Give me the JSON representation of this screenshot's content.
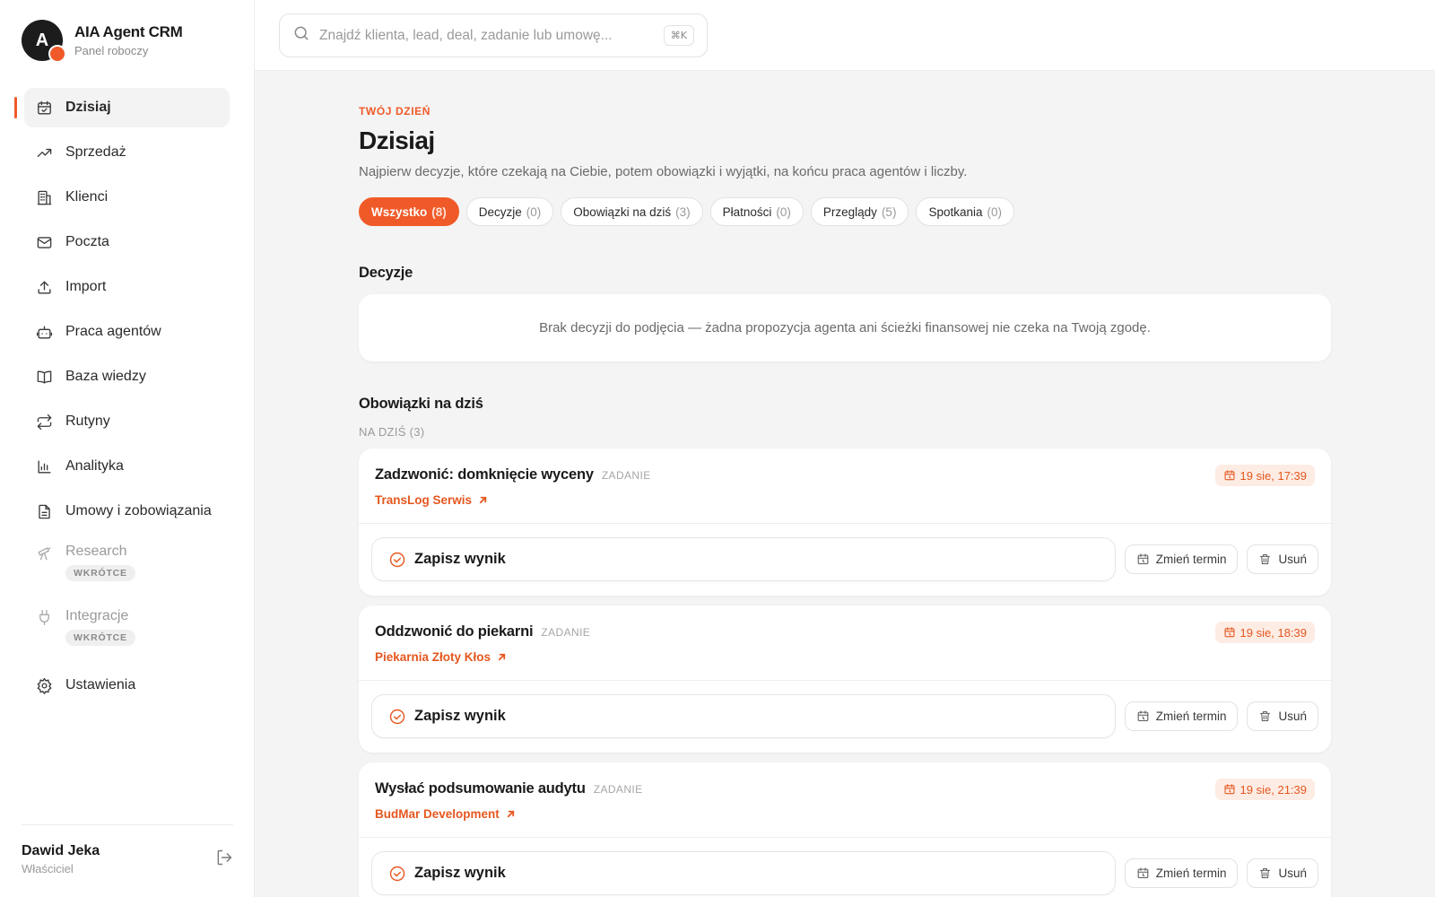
{
  "brand": {
    "avatar_letter": "A",
    "title": "AIA Agent CRM",
    "subtitle": "Panel roboczy"
  },
  "search": {
    "placeholder": "Znajdź klienta, lead, deal, zadanie lub umowę...",
    "shortcut": "⌘K"
  },
  "sidebar": {
    "items": [
      {
        "label": "Dzisiaj",
        "icon": "calendar-check-icon",
        "active": true
      },
      {
        "label": "Sprzedaż",
        "icon": "trending-up-icon"
      },
      {
        "label": "Klienci",
        "icon": "building-icon"
      },
      {
        "label": "Poczta",
        "icon": "mail-icon"
      },
      {
        "label": "Import",
        "icon": "upload-icon"
      },
      {
        "label": "Praca agentów",
        "icon": "bot-icon"
      },
      {
        "label": "Baza wiedzy",
        "icon": "book-icon"
      },
      {
        "label": "Rutyny",
        "icon": "repeat-icon"
      },
      {
        "label": "Analityka",
        "icon": "bar-chart-icon"
      },
      {
        "label": "Umowy i zobowiązania",
        "icon": "document-icon"
      },
      {
        "label": "Research",
        "icon": "telescope-icon",
        "badge": "WKRÓTCE",
        "disabled": true
      },
      {
        "label": "Integracje",
        "icon": "plug-icon",
        "badge": "WKRÓTCE",
        "disabled": true
      },
      {
        "label": "Ustawienia",
        "icon": "gear-icon"
      }
    ]
  },
  "user": {
    "name": "Dawid Jeka",
    "role": "Właściciel"
  },
  "header": {
    "eyebrow": "TWÓJ DZIEŃ",
    "title": "Dzisiaj",
    "subtitle": "Najpierw decyzje, które czekają na Ciebie, potem obowiązki i wyjątki, na końcu praca agentów i liczby."
  },
  "filters": [
    {
      "label": "Wszystko",
      "count": "(8)",
      "active": true
    },
    {
      "label": "Decyzje",
      "count": "(0)"
    },
    {
      "label": "Obowiązki na dziś",
      "count": "(3)"
    },
    {
      "label": "Płatności",
      "count": "(0)"
    },
    {
      "label": "Przeglądy",
      "count": "(5)"
    },
    {
      "label": "Spotkania",
      "count": "(0)"
    }
  ],
  "decisions": {
    "title": "Decyzje",
    "empty_text": "Brak decyzji do podjęcia — żadna propozycja agenta ani ścieżki finansowej nie czeka na Twoją zgodę."
  },
  "tasks": {
    "title": "Obowiązki na dziś",
    "group_label": "NA DZIŚ (3)",
    "save_label": "Zapisz wynik",
    "reschedule_label": "Zmień termin",
    "delete_label": "Usuń",
    "items": [
      {
        "title": "Zadzwonić: domknięcie wyceny",
        "type": "ZADANIE",
        "client": "TransLog Serwis",
        "due": "19 sie, 17:39"
      },
      {
        "title": "Oddzwonić do piekarni",
        "type": "ZADANIE",
        "client": "Piekarnia Złoty Kłos",
        "due": "19 sie, 18:39"
      },
      {
        "title": "Wysłać podsumowanie audytu",
        "type": "ZADANIE",
        "client": "BudMar Development",
        "due": "19 sie, 21:39"
      }
    ]
  },
  "colors": {
    "accent": "#f05a28",
    "accent_soft": "#fdece4"
  }
}
